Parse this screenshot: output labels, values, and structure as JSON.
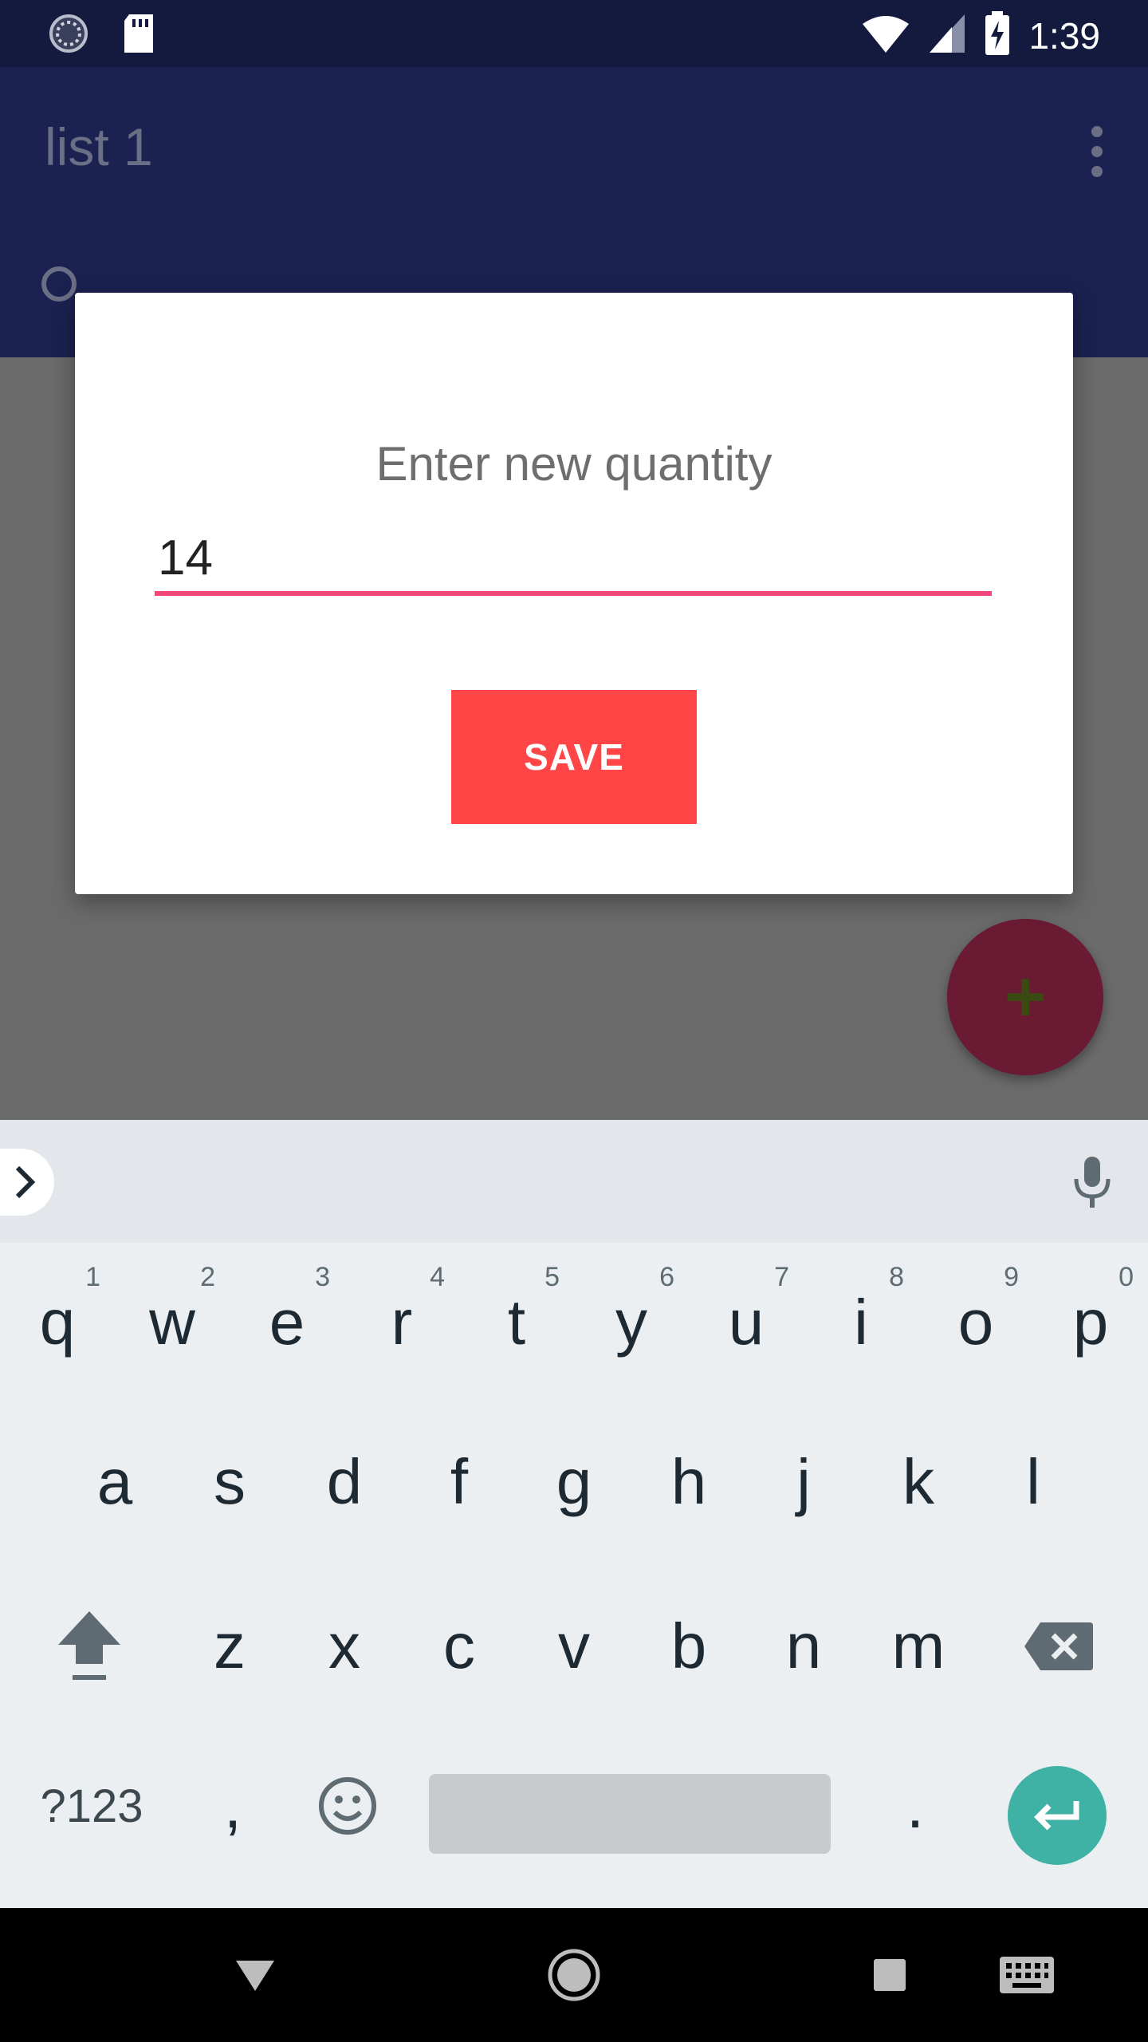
{
  "status_bar": {
    "time": "1:39",
    "icons": [
      "loading-icon",
      "sd-card-icon",
      "wifi-icon",
      "signal-icon",
      "battery-charging-icon"
    ]
  },
  "app_bar": {
    "title": "list 1",
    "overflow_icon": "more-vert-icon"
  },
  "dialog": {
    "title": "Enter new quantity",
    "input_value": "14",
    "save_label": "SAVE",
    "accent_color": "#f0467a",
    "button_color": "#ff4545"
  },
  "fab": {
    "icon": "plus-icon",
    "label": "+"
  },
  "keyboard": {
    "row1": [
      {
        "key": "q",
        "hint": "1"
      },
      {
        "key": "w",
        "hint": "2"
      },
      {
        "key": "e",
        "hint": "3"
      },
      {
        "key": "r",
        "hint": "4"
      },
      {
        "key": "t",
        "hint": "5"
      },
      {
        "key": "y",
        "hint": "6"
      },
      {
        "key": "u",
        "hint": "7"
      },
      {
        "key": "i",
        "hint": "8"
      },
      {
        "key": "o",
        "hint": "9"
      },
      {
        "key": "p",
        "hint": "0"
      }
    ],
    "row2": [
      "a",
      "s",
      "d",
      "f",
      "g",
      "h",
      "j",
      "k",
      "l"
    ],
    "row3": [
      "z",
      "x",
      "c",
      "v",
      "b",
      "n",
      "m"
    ],
    "symbols_label": "?123",
    "comma_label": ",",
    "period_label": ".",
    "enter_color": "#3fb2a5"
  },
  "nav_bar": {
    "icons": [
      "back-icon",
      "home-icon",
      "recents-icon",
      "keyboard-icon"
    ]
  }
}
